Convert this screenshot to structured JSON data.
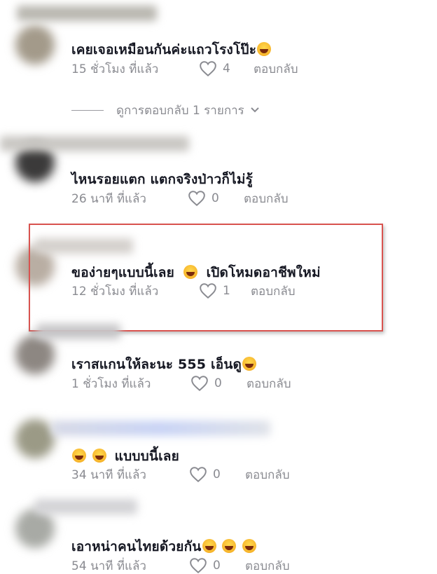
{
  "comments": [
    {
      "text": "เคยเจอเหมือนกันค่ะแถวโรงโป๊ะ",
      "emojis": [
        "rolling-on-floor-laughing"
      ],
      "time": "15 ชั่วโมง ที่แล้ว",
      "likes": "4",
      "reply": "ตอบกลับ"
    },
    {
      "text": "ไหนรอยแตก แตกจริงป่าวก็ไม่รู้",
      "emojis": [],
      "time": "26 นาที ที่แล้ว",
      "likes": "0",
      "reply": "ตอบกลับ"
    },
    {
      "text_before": "ของ่ายๆแบบนี้เลย",
      "text_after": "เปิดโหมดอาชีพใหม่",
      "emojis": [
        "grinning-squinting"
      ],
      "time": "12 ชั่วโมง ที่แล้ว",
      "likes": "1",
      "reply": "ตอบกลับ"
    },
    {
      "text": "เราสแกนให้ละนะ 555 เอ็นดู",
      "emojis": [
        "beaming-face"
      ],
      "time": "1 ชั่วโมง ที่แล้ว",
      "likes": "0",
      "reply": "ตอบกลับ"
    },
    {
      "text": "แบบบนี้เลย",
      "emojis": [
        "face-with-tears-of-joy",
        "face-with-tears-of-joy"
      ],
      "time": "34 นาที ที่แล้ว",
      "likes": "0",
      "reply": "ตอบกลับ"
    },
    {
      "text": "เอาหน่าคนไทยด้วยกัน",
      "emojis": [
        "face-with-tears-of-joy",
        "face-with-tears-of-joy",
        "face-with-tears-of-joy"
      ],
      "time": "54 นาที ที่แล้ว",
      "likes": "0",
      "reply": "ตอบกลับ"
    }
  ],
  "view_replies": {
    "label": "ดูการตอบกลับ 1 รายการ"
  },
  "colors": {
    "text": "#161823",
    "meta": "#8a8b91",
    "highlight_border": "#d9534f"
  }
}
